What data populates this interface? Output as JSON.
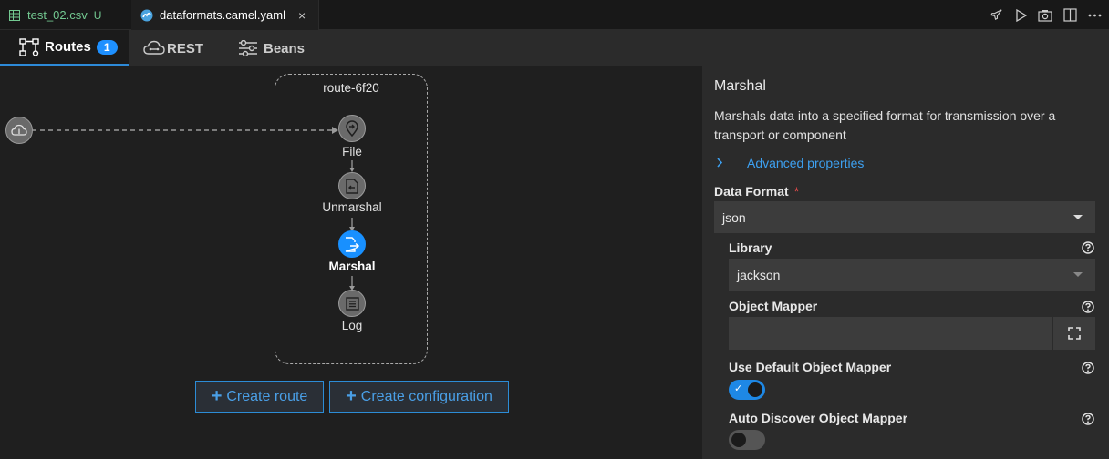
{
  "editor_tabs": [
    {
      "label": "test_02.csv",
      "status": "U"
    },
    {
      "label": "dataformats.camel.yaml",
      "close": "×"
    }
  ],
  "editor_actions": [
    "rocket-icon",
    "play-icon",
    "camera-icon",
    "split-editor-icon",
    "more-icon"
  ],
  "nav": {
    "routes": {
      "label": "Routes",
      "count": "1"
    },
    "rest": {
      "label": "REST"
    },
    "beans": {
      "label": "Beans"
    }
  },
  "canvas": {
    "route_id": "route-6f20",
    "nodes": [
      "File",
      "Unmarshal",
      "Marshal",
      "Log"
    ],
    "selected_node": "Marshal",
    "buttons": {
      "create_route": "Create route",
      "create_configuration": "Create configuration"
    }
  },
  "panel": {
    "title": "Marshal",
    "description": "Marshals data into a specified format for transmission over a transport or component",
    "advanced": "Advanced properties",
    "data_format": {
      "label": "Data Format",
      "required_mark": "*",
      "value": "json"
    },
    "library": {
      "label": "Library",
      "value": "jackson"
    },
    "object_mapper": {
      "label": "Object Mapper",
      "value": ""
    },
    "use_default_object_mapper": {
      "label": "Use Default Object Mapper",
      "enabled": true
    },
    "auto_discover_object_mapper": {
      "label": "Auto Discover Object Mapper",
      "enabled": false
    }
  },
  "colors": {
    "accent": "#1890ff",
    "tab_underline": "#2d8ad8",
    "panel_bg": "#2b2b2b",
    "canvas_bg": "#1f1f1f"
  }
}
